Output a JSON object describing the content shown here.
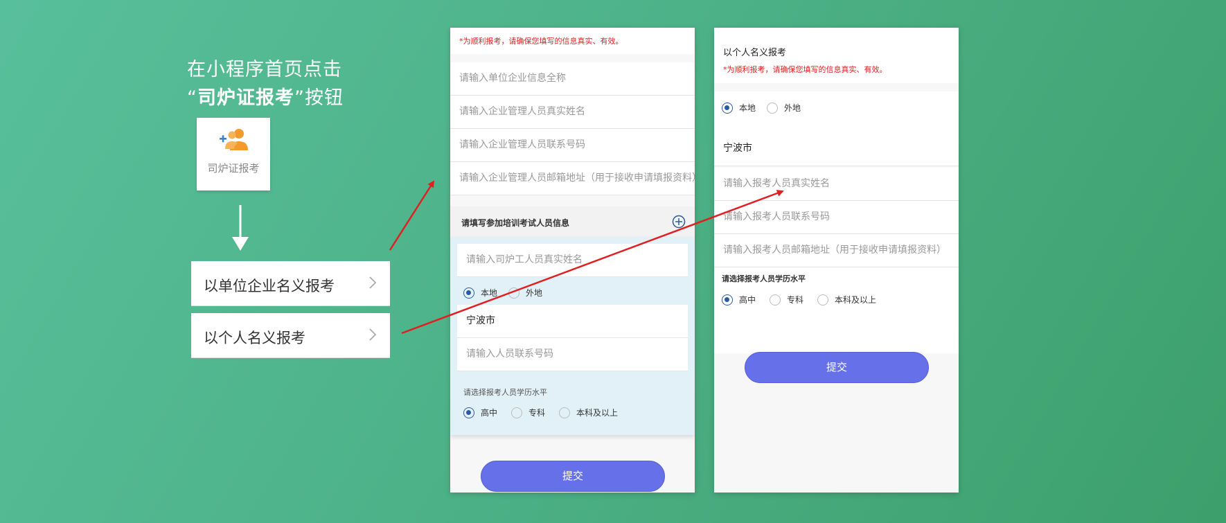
{
  "intro": {
    "line1": "在小程序首页点击",
    "line2_open_quote": "“",
    "line2_bold": "司炉证报考",
    "line2_close": "”按钮"
  },
  "entry": {
    "label": "司炉证报考",
    "icon": "add-users-icon"
  },
  "options": [
    {
      "label": "以单位企业名义报考"
    },
    {
      "label": "以个人名义报考"
    }
  ],
  "company_form": {
    "notice": "*为顺利报考，请确保您填写的信息真实、有效。",
    "fields": [
      "请输入单位企业信息全称",
      "请输入企业管理人员真实姓名",
      "请输入企业管理人员联系号码",
      "请输入企业管理人员邮箱地址（用于接收申请填报资料）"
    ],
    "section_title": "请填写参加培训考试人员信息",
    "worker_name_placeholder": "请输入司炉工人员真实姓名",
    "location_options": [
      "本地",
      "外地"
    ],
    "city": "宁波市",
    "phone_placeholder": "请输入人员联系号码",
    "education_label": "请选择报考人员学历水平",
    "education_options": [
      "高中",
      "专科",
      "本科及以上"
    ],
    "submit": "提交"
  },
  "personal_form": {
    "title": "以个人名义报考",
    "notice": "*为顺利报考，请确保您填写的信息真实、有效。",
    "location_options": [
      "本地",
      "外地"
    ],
    "city": "宁波市",
    "fields": [
      "请输入报考人员真实姓名",
      "请输入报考人员联系号码",
      "请输入报考人员邮箱地址（用于接收申请填报资料）"
    ],
    "education_label": "请选择报考人员学历水平",
    "education_options": [
      "高中",
      "专科",
      "本科及以上"
    ],
    "submit": "提交"
  },
  "colors": {
    "accent": "#6670e8",
    "notice": "#e02020",
    "radio": "#2c5aa0",
    "arrow": "#e02020",
    "entry_icon": "#f39a2b"
  }
}
